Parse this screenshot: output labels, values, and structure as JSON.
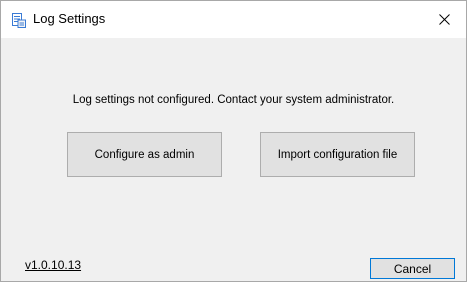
{
  "window": {
    "title": "Log Settings",
    "app_icon": "log-settings-icon",
    "close_icon": "close-icon"
  },
  "main": {
    "message": "Log settings not configured. Contact your system administrator.",
    "configure_admin_label": "Configure as admin",
    "import_config_label": "Import configuration file"
  },
  "footer": {
    "version": "v1.0.10.13",
    "cancel_label": "Cancel"
  },
  "colors": {
    "titlebar": "#ffffff",
    "body": "#f0f0f0",
    "button": "#e1e1e1",
    "button_border": "#adadad",
    "focus_border": "#0078d7"
  }
}
